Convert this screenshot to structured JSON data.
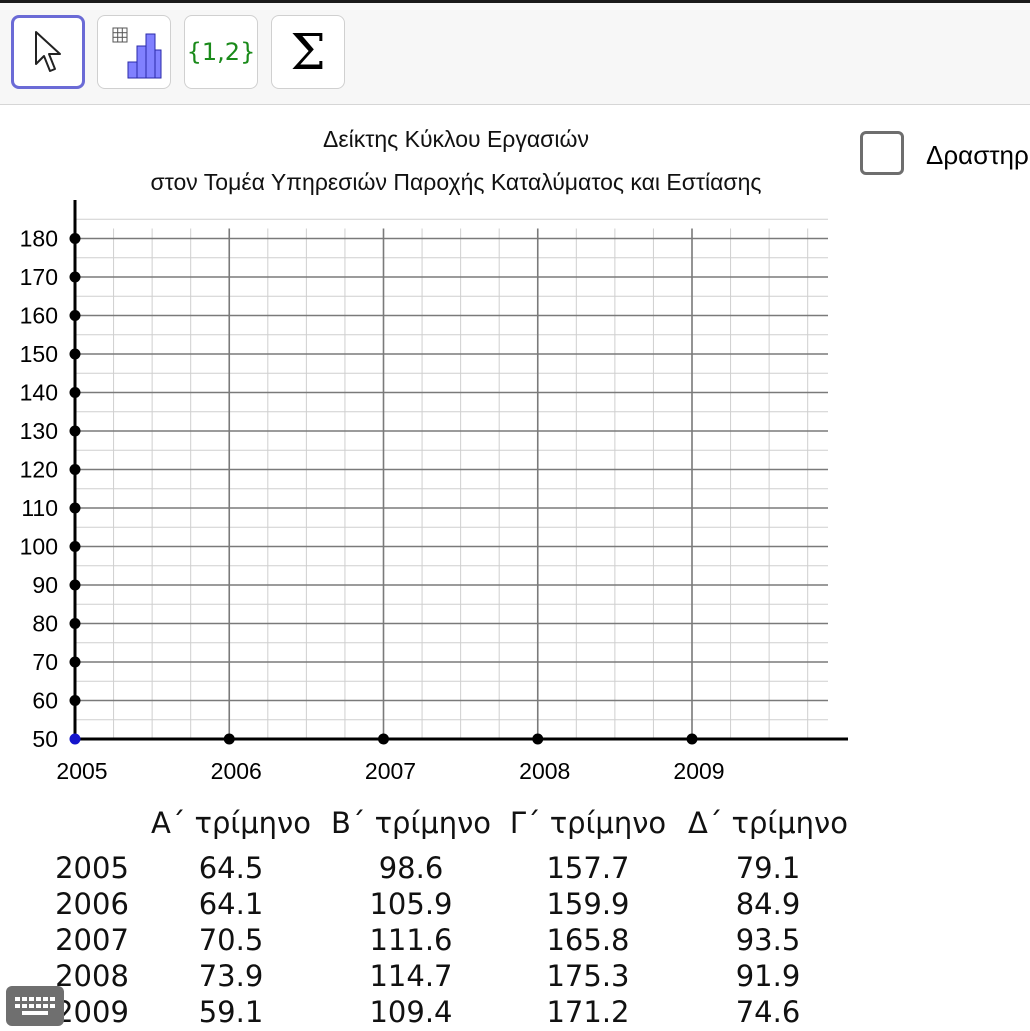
{
  "toolbar": {
    "tools": [
      {
        "name": "move",
        "icon": "cursor-arrow-icon",
        "selected": true
      },
      {
        "name": "histogram",
        "icon": "histogram-icon",
        "selected": false
      },
      {
        "name": "list",
        "icon": "set-braces-icon",
        "label": "{1,2}",
        "selected": false
      },
      {
        "name": "sum",
        "icon": "sigma-icon",
        "label": "Σ",
        "selected": false
      }
    ]
  },
  "chart": {
    "title_line1": "Δείκτης Κύκλου Εργασιών",
    "title_line2": "στον Τομέα Υπηρεσιών Παροχής Καταλύματος και Εστίασης"
  },
  "checkbox": {
    "label": "Δραστηρ",
    "checked": false
  },
  "chart_data": {
    "type": "line",
    "title": "Δείκτης Κύκλου Εργασιών στον Τομέα Υπηρεσιών Παροχής Καταλύματος και Εστίασης",
    "x_ticks": [
      "2005",
      "2006",
      "2007",
      "2008",
      "2009"
    ],
    "y_ticks": [
      "50",
      "60",
      "70",
      "80",
      "90",
      "100",
      "110",
      "120",
      "130",
      "140",
      "150",
      "160",
      "170",
      "180"
    ],
    "xlim": [
      2005,
      2010
    ],
    "ylim": [
      50,
      180
    ],
    "grid": true,
    "x_minor_per_year": 4,
    "y_minor_step": 5,
    "series": []
  },
  "table": {
    "headers": [
      "Α΄ τρίμηνο",
      "Β΄ τρίμηνο",
      "Γ΄ τρίμηνο",
      "Δ΄ τρίμηνο"
    ],
    "rows": [
      {
        "year": "2005",
        "values": [
          "64.5",
          "98.6",
          "157.7",
          "79.1"
        ]
      },
      {
        "year": "2006",
        "values": [
          "64.1",
          "105.9",
          "159.9",
          "84.9"
        ]
      },
      {
        "year": "2007",
        "values": [
          "70.5",
          "111.6",
          "165.8",
          "93.5"
        ]
      },
      {
        "year": "2008",
        "values": [
          "73.9",
          "114.7",
          "175.3",
          "91.9"
        ]
      },
      {
        "year": "2009",
        "values": [
          "59.1",
          "109.4",
          "171.2",
          "74.6"
        ]
      }
    ]
  },
  "keyboard": {
    "icon": "keyboard-icon"
  }
}
